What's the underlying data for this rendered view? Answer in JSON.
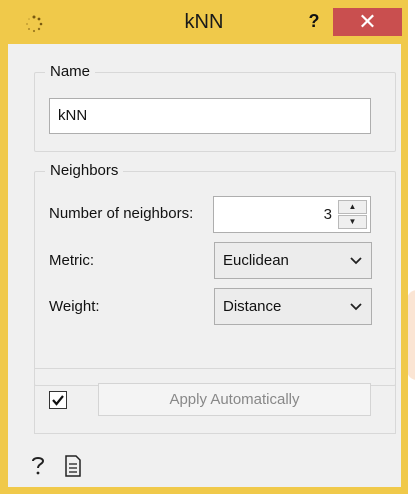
{
  "window": {
    "title": "kNN",
    "help_glyph": "?",
    "close_glyph": "✕",
    "app_icon": "spinner-dots-icon"
  },
  "name_group": {
    "title": "Name",
    "input_value": "kNN"
  },
  "neighbors_group": {
    "title": "Neighbors",
    "number_label": "Number of neighbors:",
    "number_value": "3",
    "metric_label": "Metric:",
    "metric_value": "Euclidean",
    "weight_label": "Weight:",
    "weight_value": "Distance"
  },
  "apply": {
    "checked": true,
    "button_label": "Apply Automatically"
  },
  "footer": {
    "help_icon": "question-mark-icon",
    "report_icon": "document-icon"
  },
  "colors": {
    "titlebar": "#f0c94a",
    "close": "#c94f4f",
    "client": "#f0f0f0"
  }
}
